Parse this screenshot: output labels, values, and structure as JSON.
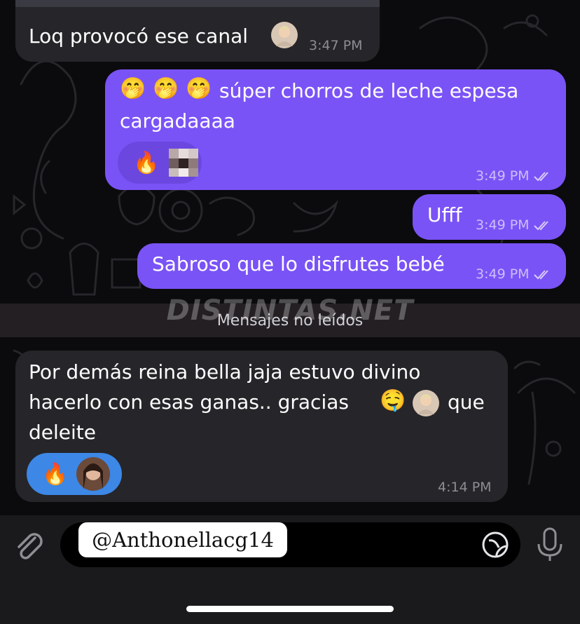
{
  "colors": {
    "outgoing_bubble": "#7a53f6",
    "incoming_bubble": "#262529",
    "reaction_pill": "#3d87e6",
    "background": "#0b0b0d"
  },
  "messages": [
    {
      "text": "Loq provocó ese canal",
      "time": "3:47 PM",
      "direction": "incoming"
    },
    {
      "text": "súper chorros de leche espesa\ncargadaaaa",
      "time": "3:49 PM",
      "direction": "outgoing",
      "status": "read",
      "reaction": "🔥"
    },
    {
      "text": "Ufff",
      "time": "3:49 PM",
      "direction": "outgoing",
      "status": "read"
    },
    {
      "text": "Sabroso que lo disfrutes bebé",
      "time": "3:49 PM",
      "direction": "outgoing",
      "status": "read"
    },
    {
      "text_line1": "Por demás reina bella jaja estuvo divino",
      "text_line2a": "hacerlo con esas ganas.. gracias",
      "text_line2b": "que",
      "text_line3": "deleite",
      "time": "4:14 PM",
      "direction": "incoming",
      "reaction": "🔥"
    }
  ],
  "emojis": {
    "hand_over_mouth": "🤭",
    "drooling": "🤤"
  },
  "unread_divider": "Mensajes no leídos",
  "watermark": "DISTINTAS.NET",
  "username_overlay": "@Anthonellacg14",
  "icons": {
    "attach": "paperclip-icon",
    "sticker": "sticker-icon",
    "mic": "microphone-icon",
    "read": "double-check-icon"
  }
}
